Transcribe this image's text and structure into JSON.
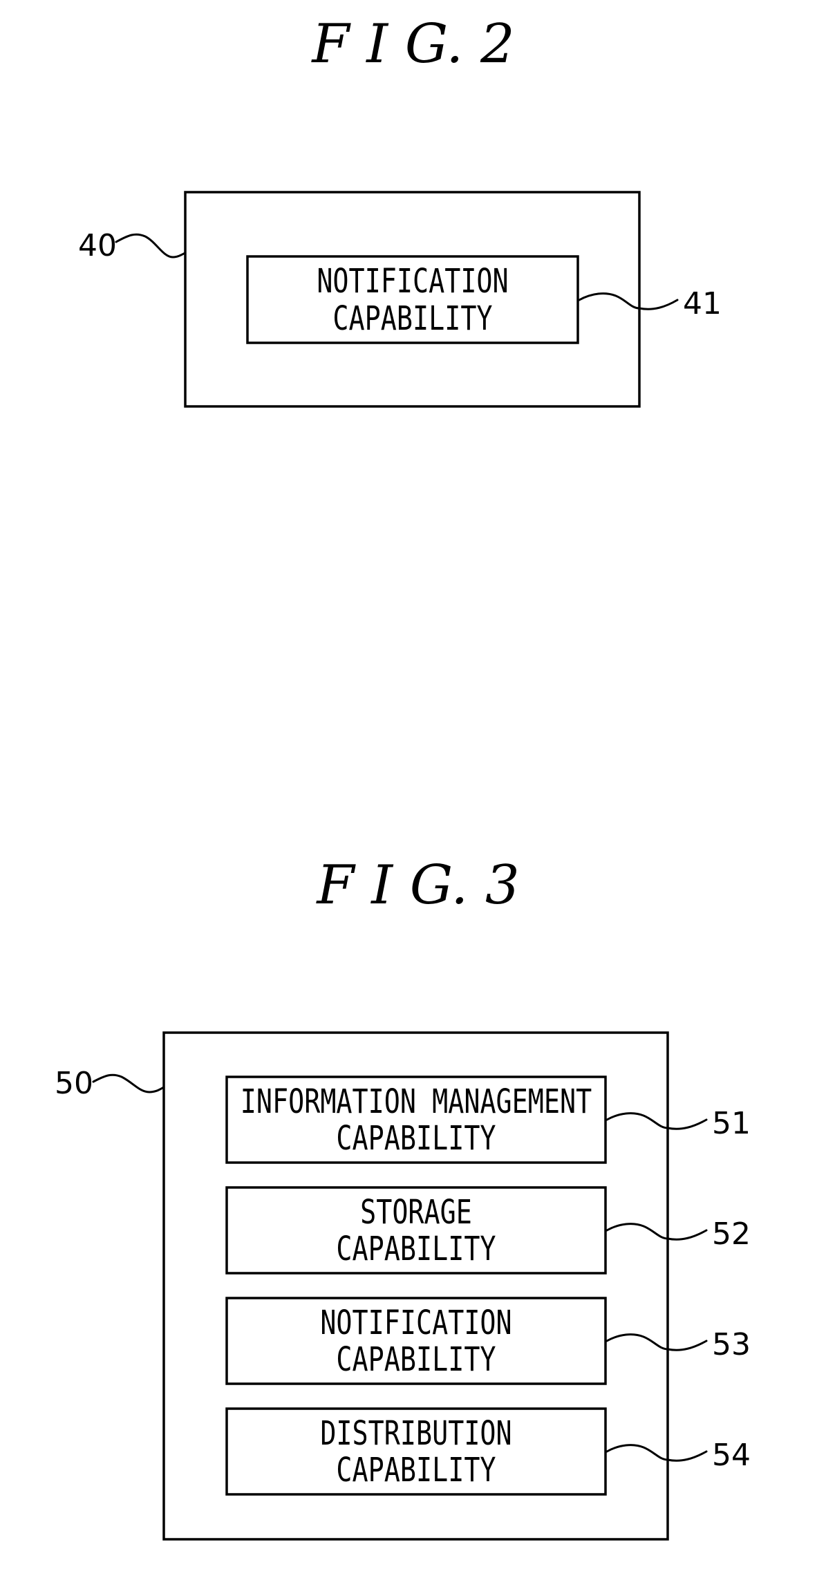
{
  "figures": [
    {
      "title": "F I G. 2",
      "container": {
        "ref": "40"
      },
      "components": [
        {
          "ref": "41",
          "lines": [
            "NOTIFICATION",
            "CAPABILITY"
          ]
        }
      ]
    },
    {
      "title": "F I G. 3",
      "container": {
        "ref": "50"
      },
      "components": [
        {
          "ref": "51",
          "lines": [
            "INFORMATION MANAGEMENT",
            "CAPABILITY"
          ]
        },
        {
          "ref": "52",
          "lines": [
            "STORAGE",
            "CAPABILITY"
          ]
        },
        {
          "ref": "53",
          "lines": [
            "NOTIFICATION",
            "CAPABILITY"
          ]
        },
        {
          "ref": "54",
          "lines": [
            "DISTRIBUTION",
            "CAPABILITY"
          ]
        }
      ]
    }
  ]
}
